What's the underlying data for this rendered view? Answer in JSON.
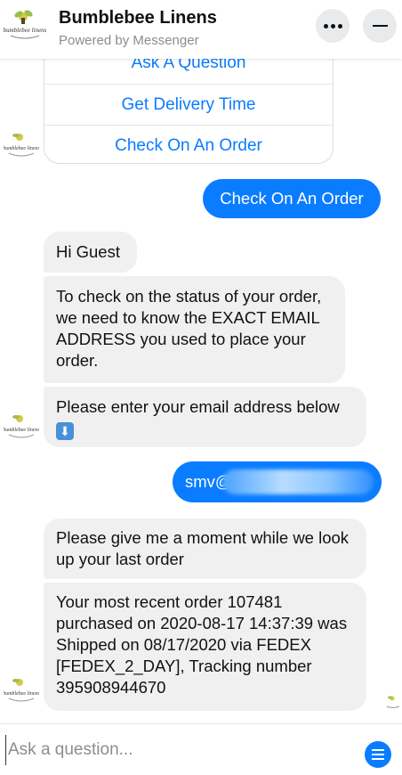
{
  "header": {
    "title": "Bumblebee Linens",
    "subtitle": "Powered by Messenger",
    "logo_text": "bumblebee linens"
  },
  "quick_replies": [
    "Ask A Question",
    "Get Delivery Time",
    "Check On An Order"
  ],
  "messages": [
    {
      "from": "user",
      "text": "Check On An Order"
    },
    {
      "from": "bot",
      "text": "Hi Guest"
    },
    {
      "from": "bot",
      "text": "To check on the status of your order, we need to know the EXACT EMAIL ADDRESS you used to place your order."
    },
    {
      "from": "bot",
      "text": "Please enter your email address below",
      "emoji": "⬇"
    },
    {
      "from": "user",
      "text": "smv@"
    },
    {
      "from": "bot",
      "text": "Please give me a moment while we look up your last order"
    },
    {
      "from": "bot",
      "text": "Your most recent order 107481 purchased on 2020-08-17 14:37:39 was Shipped on 08/17/2020 via FEDEX [FEDEX_2_DAY], Tracking number 395908944670"
    }
  ],
  "composer": {
    "placeholder": "Ask a question..."
  },
  "colors": {
    "accent": "#0a7cff",
    "bot_bubble": "#f0f0f0",
    "muted": "#8a8d91"
  },
  "icons": [
    "more-icon",
    "minimize-icon",
    "menu-icon",
    "down-arrow-emoji"
  ]
}
